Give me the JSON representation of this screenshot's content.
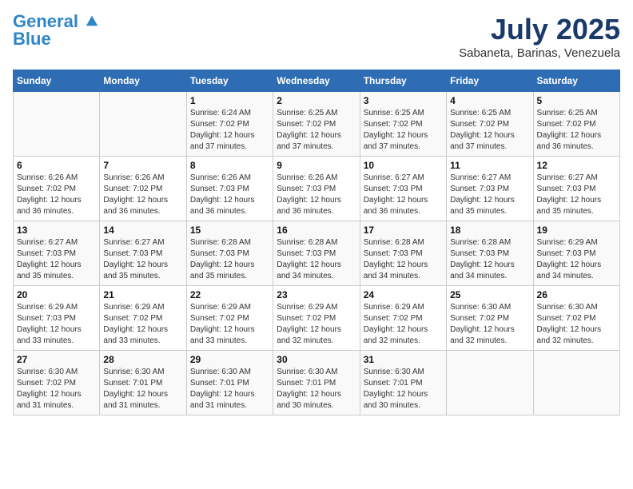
{
  "header": {
    "logo_line1": "General",
    "logo_line2": "Blue",
    "month": "July 2025",
    "location": "Sabaneta, Barinas, Venezuela"
  },
  "weekdays": [
    "Sunday",
    "Monday",
    "Tuesday",
    "Wednesday",
    "Thursday",
    "Friday",
    "Saturday"
  ],
  "weeks": [
    [
      {
        "day": "",
        "sunrise": "",
        "sunset": "",
        "daylight": ""
      },
      {
        "day": "",
        "sunrise": "",
        "sunset": "",
        "daylight": ""
      },
      {
        "day": "1",
        "sunrise": "Sunrise: 6:24 AM",
        "sunset": "Sunset: 7:02 PM",
        "daylight": "Daylight: 12 hours and 37 minutes."
      },
      {
        "day": "2",
        "sunrise": "Sunrise: 6:25 AM",
        "sunset": "Sunset: 7:02 PM",
        "daylight": "Daylight: 12 hours and 37 minutes."
      },
      {
        "day": "3",
        "sunrise": "Sunrise: 6:25 AM",
        "sunset": "Sunset: 7:02 PM",
        "daylight": "Daylight: 12 hours and 37 minutes."
      },
      {
        "day": "4",
        "sunrise": "Sunrise: 6:25 AM",
        "sunset": "Sunset: 7:02 PM",
        "daylight": "Daylight: 12 hours and 37 minutes."
      },
      {
        "day": "5",
        "sunrise": "Sunrise: 6:25 AM",
        "sunset": "Sunset: 7:02 PM",
        "daylight": "Daylight: 12 hours and 36 minutes."
      }
    ],
    [
      {
        "day": "6",
        "sunrise": "Sunrise: 6:26 AM",
        "sunset": "Sunset: 7:02 PM",
        "daylight": "Daylight: 12 hours and 36 minutes."
      },
      {
        "day": "7",
        "sunrise": "Sunrise: 6:26 AM",
        "sunset": "Sunset: 7:02 PM",
        "daylight": "Daylight: 12 hours and 36 minutes."
      },
      {
        "day": "8",
        "sunrise": "Sunrise: 6:26 AM",
        "sunset": "Sunset: 7:03 PM",
        "daylight": "Daylight: 12 hours and 36 minutes."
      },
      {
        "day": "9",
        "sunrise": "Sunrise: 6:26 AM",
        "sunset": "Sunset: 7:03 PM",
        "daylight": "Daylight: 12 hours and 36 minutes."
      },
      {
        "day": "10",
        "sunrise": "Sunrise: 6:27 AM",
        "sunset": "Sunset: 7:03 PM",
        "daylight": "Daylight: 12 hours and 36 minutes."
      },
      {
        "day": "11",
        "sunrise": "Sunrise: 6:27 AM",
        "sunset": "Sunset: 7:03 PM",
        "daylight": "Daylight: 12 hours and 35 minutes."
      },
      {
        "day": "12",
        "sunrise": "Sunrise: 6:27 AM",
        "sunset": "Sunset: 7:03 PM",
        "daylight": "Daylight: 12 hours and 35 minutes."
      }
    ],
    [
      {
        "day": "13",
        "sunrise": "Sunrise: 6:27 AM",
        "sunset": "Sunset: 7:03 PM",
        "daylight": "Daylight: 12 hours and 35 minutes."
      },
      {
        "day": "14",
        "sunrise": "Sunrise: 6:27 AM",
        "sunset": "Sunset: 7:03 PM",
        "daylight": "Daylight: 12 hours and 35 minutes."
      },
      {
        "day": "15",
        "sunrise": "Sunrise: 6:28 AM",
        "sunset": "Sunset: 7:03 PM",
        "daylight": "Daylight: 12 hours and 35 minutes."
      },
      {
        "day": "16",
        "sunrise": "Sunrise: 6:28 AM",
        "sunset": "Sunset: 7:03 PM",
        "daylight": "Daylight: 12 hours and 34 minutes."
      },
      {
        "day": "17",
        "sunrise": "Sunrise: 6:28 AM",
        "sunset": "Sunset: 7:03 PM",
        "daylight": "Daylight: 12 hours and 34 minutes."
      },
      {
        "day": "18",
        "sunrise": "Sunrise: 6:28 AM",
        "sunset": "Sunset: 7:03 PM",
        "daylight": "Daylight: 12 hours and 34 minutes."
      },
      {
        "day": "19",
        "sunrise": "Sunrise: 6:29 AM",
        "sunset": "Sunset: 7:03 PM",
        "daylight": "Daylight: 12 hours and 34 minutes."
      }
    ],
    [
      {
        "day": "20",
        "sunrise": "Sunrise: 6:29 AM",
        "sunset": "Sunset: 7:03 PM",
        "daylight": "Daylight: 12 hours and 33 minutes."
      },
      {
        "day": "21",
        "sunrise": "Sunrise: 6:29 AM",
        "sunset": "Sunset: 7:02 PM",
        "daylight": "Daylight: 12 hours and 33 minutes."
      },
      {
        "day": "22",
        "sunrise": "Sunrise: 6:29 AM",
        "sunset": "Sunset: 7:02 PM",
        "daylight": "Daylight: 12 hours and 33 minutes."
      },
      {
        "day": "23",
        "sunrise": "Sunrise: 6:29 AM",
        "sunset": "Sunset: 7:02 PM",
        "daylight": "Daylight: 12 hours and 32 minutes."
      },
      {
        "day": "24",
        "sunrise": "Sunrise: 6:29 AM",
        "sunset": "Sunset: 7:02 PM",
        "daylight": "Daylight: 12 hours and 32 minutes."
      },
      {
        "day": "25",
        "sunrise": "Sunrise: 6:30 AM",
        "sunset": "Sunset: 7:02 PM",
        "daylight": "Daylight: 12 hours and 32 minutes."
      },
      {
        "day": "26",
        "sunrise": "Sunrise: 6:30 AM",
        "sunset": "Sunset: 7:02 PM",
        "daylight": "Daylight: 12 hours and 32 minutes."
      }
    ],
    [
      {
        "day": "27",
        "sunrise": "Sunrise: 6:30 AM",
        "sunset": "Sunset: 7:02 PM",
        "daylight": "Daylight: 12 hours and 31 minutes."
      },
      {
        "day": "28",
        "sunrise": "Sunrise: 6:30 AM",
        "sunset": "Sunset: 7:01 PM",
        "daylight": "Daylight: 12 hours and 31 minutes."
      },
      {
        "day": "29",
        "sunrise": "Sunrise: 6:30 AM",
        "sunset": "Sunset: 7:01 PM",
        "daylight": "Daylight: 12 hours and 31 minutes."
      },
      {
        "day": "30",
        "sunrise": "Sunrise: 6:30 AM",
        "sunset": "Sunset: 7:01 PM",
        "daylight": "Daylight: 12 hours and 30 minutes."
      },
      {
        "day": "31",
        "sunrise": "Sunrise: 6:30 AM",
        "sunset": "Sunset: 7:01 PM",
        "daylight": "Daylight: 12 hours and 30 minutes."
      },
      {
        "day": "",
        "sunrise": "",
        "sunset": "",
        "daylight": ""
      },
      {
        "day": "",
        "sunrise": "",
        "sunset": "",
        "daylight": ""
      }
    ]
  ]
}
